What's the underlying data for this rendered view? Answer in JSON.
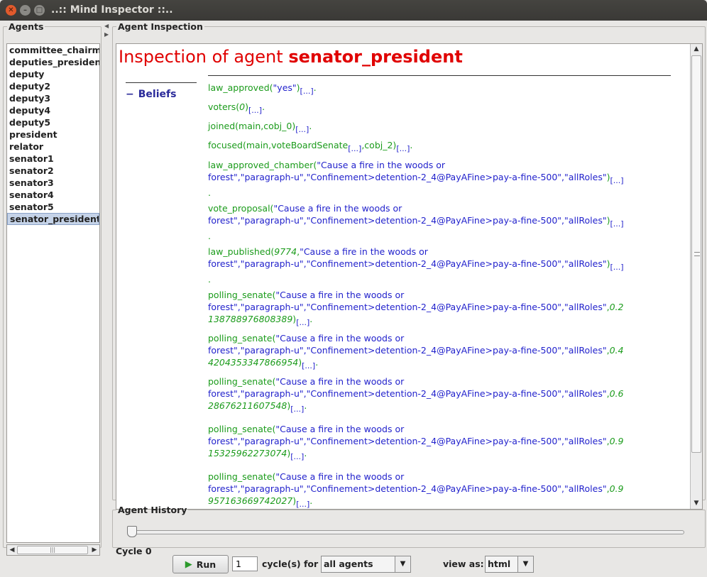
{
  "window": {
    "title": "..:: Mind Inspector ::.."
  },
  "agents_panel": {
    "legend": "Agents",
    "items": [
      "committee_chairman",
      "deputies_president",
      "deputy",
      "deputy2",
      "deputy3",
      "deputy4",
      "deputy5",
      "president",
      "relator",
      "senator1",
      "senator2",
      "senator3",
      "senator4",
      "senator5",
      "senator_president"
    ],
    "selected": "senator_president"
  },
  "inspection": {
    "legend": "Agent Inspection",
    "title_prefix": "Inspection of agent",
    "agent_name": "senator_president",
    "beliefs_label": "Beliefs",
    "annotation": "[...]"
  },
  "history": {
    "legend": "Agent History",
    "cycle_label": "Cycle 0"
  },
  "controls": {
    "run_label": "Run",
    "cycles_value": "1",
    "cycles_label": "cycle(s)  for",
    "agents_option": "all agents",
    "view_as_label": "view as:",
    "view_option": "html"
  },
  "colors": {
    "title_red": "#e00000",
    "functor_green": "#1b9b1b",
    "string_blue": "#2222cc",
    "selection": "#c5d3e8"
  }
}
